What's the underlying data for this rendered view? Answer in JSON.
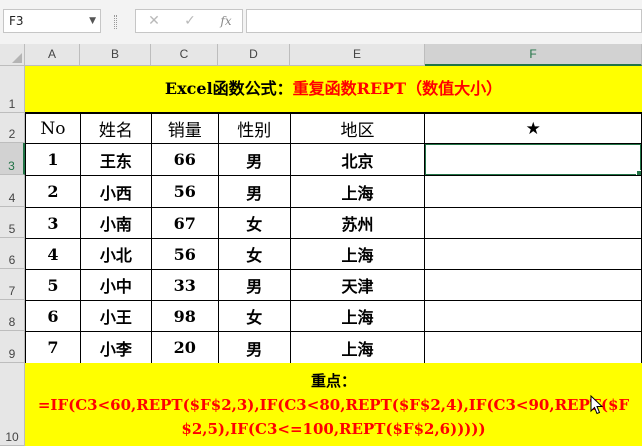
{
  "formula_bar": {
    "name_box": "F3",
    "name_box_dropdown_icon": "chevron-down-icon",
    "cancel_glyph": "✕",
    "enter_glyph": "✓",
    "function_glyph": "fx",
    "formula_value": ""
  },
  "columns": [
    "A",
    "B",
    "C",
    "D",
    "E",
    "F"
  ],
  "rows": [
    "1",
    "2",
    "3",
    "4",
    "5",
    "6",
    "7",
    "8",
    "9",
    "10"
  ],
  "selected_cell": "F3",
  "title": {
    "part1": "Excel函数公式：",
    "part2": "重复函数REPT（数值大小）"
  },
  "table": {
    "headers": [
      "No",
      "姓名",
      "销量",
      "性别",
      "地区",
      "★"
    ],
    "rows": [
      [
        "1",
        "王东",
        "66",
        "男",
        "北京",
        ""
      ],
      [
        "2",
        "小西",
        "56",
        "男",
        "上海",
        ""
      ],
      [
        "3",
        "小南",
        "67",
        "女",
        "苏州",
        ""
      ],
      [
        "4",
        "小北",
        "56",
        "女",
        "上海",
        ""
      ],
      [
        "5",
        "小中",
        "33",
        "男",
        "天津",
        ""
      ],
      [
        "6",
        "小王",
        "98",
        "女",
        "上海",
        ""
      ],
      [
        "7",
        "小李",
        "20",
        "男",
        "上海",
        ""
      ]
    ]
  },
  "note": {
    "heading": "重点：",
    "formula": "=IF(C3<60,REPT($F$2,3),IF(C3<80,REPT($F$2,4),IF(C3<90,REPT($F$2,5),IF(C3<=100,REPT($F$2,6)))))"
  },
  "colors": {
    "highlight": "#ffff00",
    "accent_red": "#ff0000",
    "selection": "#217346"
  }
}
